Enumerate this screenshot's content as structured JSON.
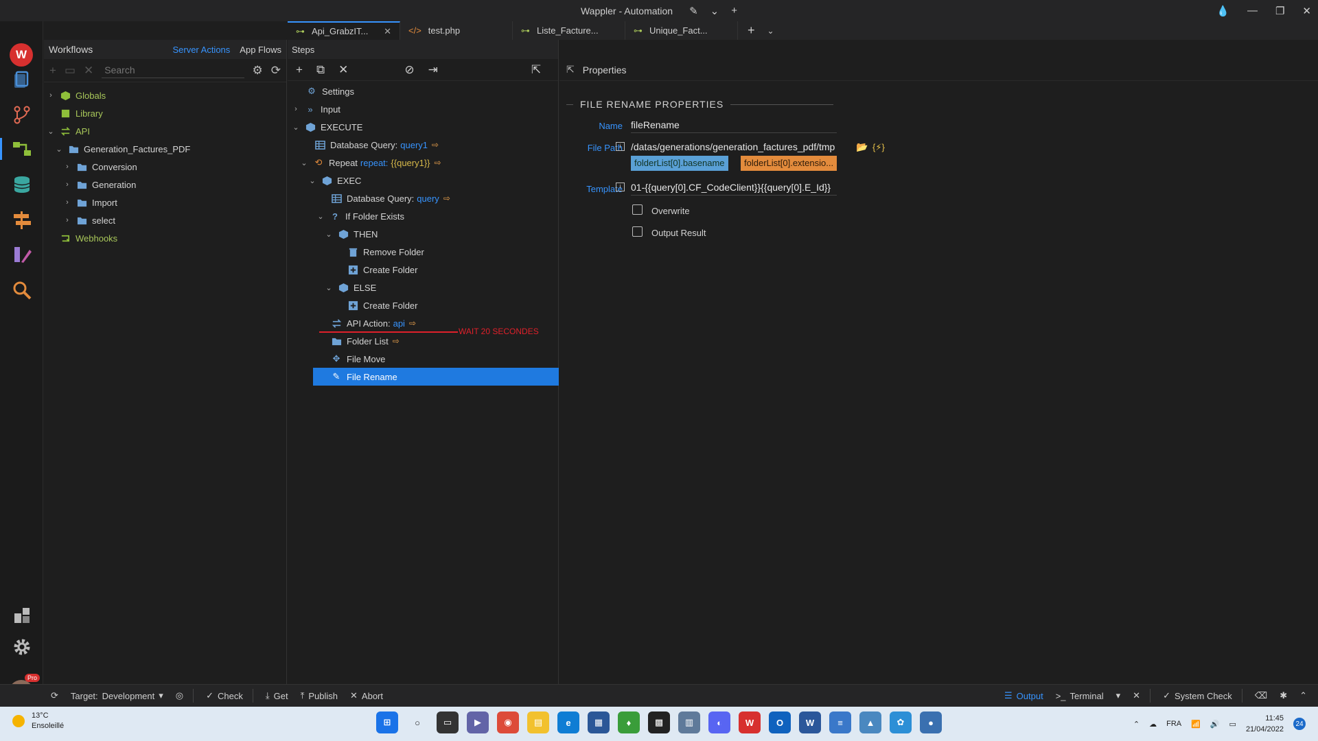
{
  "window": {
    "title": "Wappler - Automation"
  },
  "tabs": [
    {
      "label": "Api_GrabzIT...",
      "active": true
    },
    {
      "label": "test.php",
      "active": false
    },
    {
      "label": "Liste_Facture...",
      "active": false
    },
    {
      "label": "Unique_Fact...",
      "active": false
    }
  ],
  "workflows": {
    "title": "Workflows",
    "links": {
      "server_actions": "Server Actions",
      "app_flows": "App Flows"
    },
    "search_placeholder": "Search",
    "tree": [
      {
        "label": "Globals"
      },
      {
        "label": "Library"
      },
      {
        "label": "API"
      },
      {
        "label": "Generation_Factures_PDF"
      },
      {
        "label": "Conversion"
      },
      {
        "label": "Generation"
      },
      {
        "label": "Import"
      },
      {
        "label": "select"
      },
      {
        "label": "Webhooks"
      }
    ]
  },
  "steps": {
    "title": "Steps",
    "items": [
      {
        "label": "Settings"
      },
      {
        "label": "Input"
      },
      {
        "label": "EXECUTE"
      },
      {
        "label": "Database Query:",
        "value": "query1"
      },
      {
        "label": "Repeat",
        "kw": "repeat:",
        "value": "{{query1}}"
      },
      {
        "label": "EXEC"
      },
      {
        "label": "Database Query:",
        "value": "query"
      },
      {
        "label": "If Folder Exists"
      },
      {
        "label": "THEN"
      },
      {
        "label": "Remove Folder"
      },
      {
        "label": "Create Folder"
      },
      {
        "label": "ELSE"
      },
      {
        "label": "Create Folder"
      },
      {
        "label": "API Action:",
        "value": "api"
      },
      {
        "label": "Folder List"
      },
      {
        "label": "File Move"
      },
      {
        "label": "File Rename"
      }
    ],
    "annotation": "WAIT 20 SECONDES"
  },
  "properties": {
    "title": "Properties",
    "section": "FILE RENAME PROPERTIES",
    "name_label": "Name",
    "name_value": "fileRename",
    "filepath_label": "File Path",
    "filepath_value": "/datas/generations/generation_factures_pdf/tmp",
    "chip_basename": "folderList[0].basename",
    "chip_extension": "folderList[0].extensio...",
    "template_label": "Template",
    "template_value": "01-{{query[0].CF_CodeClient}}{{query[0].E_Id}}",
    "overwrite_label": "Overwrite",
    "output_label": "Output Result",
    "dyn_label": "{⚡}"
  },
  "statusbar": {
    "target_label": "Target:",
    "target_value": "Development",
    "check": "Check",
    "get": "Get",
    "publish": "Publish",
    "abort": "Abort",
    "output": "Output",
    "terminal": "Terminal",
    "system_check": "System Check"
  },
  "taskbar": {
    "temp": "13°C",
    "weather": "Ensoleillé",
    "lang": "FRA",
    "time": "11:45",
    "date": "21/04/2022",
    "notifications": "24"
  },
  "colors": {
    "accent": "#3794ff",
    "selected": "#1f7ae0",
    "annotation": "#e0202a"
  }
}
